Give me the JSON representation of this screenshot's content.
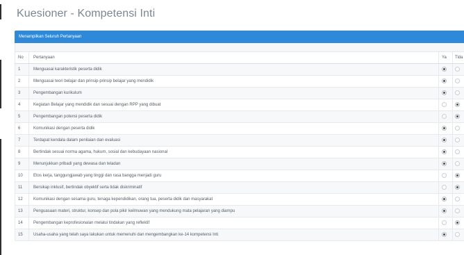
{
  "page": {
    "title": "Kuesioner - Kompetensi Inti"
  },
  "panel": {
    "header": "Menampilkan Seluruh Pertanyaan"
  },
  "table": {
    "headers": {
      "no": "No",
      "question": "Pertanyaan",
      "yes": "Ya",
      "no_answer": "Tida"
    },
    "rows": [
      {
        "no": "1",
        "question": "Menguasai karakteristik peserta didik",
        "answer": "ya"
      },
      {
        "no": "2",
        "question": "Menguasai teori belajar dan prinsip-prinsip belajar yang mendidik",
        "answer": "ya"
      },
      {
        "no": "3",
        "question": "Pengembangan kurikulum",
        "answer": "ya"
      },
      {
        "no": "4",
        "question": "Kegiatan Belajar yang mendidik dan sesuai dengan RPP yang dibuat",
        "answer": "tidak"
      },
      {
        "no": "5",
        "question": "Pengembangan potensi peserta didik",
        "answer": "tidak"
      },
      {
        "no": "6",
        "question": "Komunikasi dengan peserta didik",
        "answer": "ya"
      },
      {
        "no": "7",
        "question": "Terdapat kendala dalam penilaian dan evaluasi",
        "answer": "ya"
      },
      {
        "no": "8",
        "question": "Bertindak sesuai norma agama, hukum, sosial dan kebudayaan nasional",
        "answer": "ya"
      },
      {
        "no": "9",
        "question": "Menunjukkan pribadi yang dewasa dan teladan",
        "answer": "ya"
      },
      {
        "no": "10",
        "question": "Etos kerja, tanggungjawab yang tinggi dan rasa bangga menjadi guru",
        "answer": "tidak"
      },
      {
        "no": "11",
        "question": "Bersikap inklusif, bertindak obyektif serta tidak diskriminatif",
        "answer": "tidak"
      },
      {
        "no": "12",
        "question": "Komunikasi dengan sesama guru, tenaga kependidikan, orang tua, peserta didik dan masyarakat",
        "answer": "ya"
      },
      {
        "no": "13",
        "question": "Penguasaan materi, struktur, konsep dan pola pikir keilmuwan yang mendukung mata pelajaran yang diampu",
        "answer": "ya"
      },
      {
        "no": "14",
        "question": "Pengembangan keprofesionalan melalui tindakan yang reflektif",
        "answer": "tidak"
      },
      {
        "no": "15",
        "question": "Usaha-usaha yang telah saya lakukan untuk memenuhi dan mengembangkan ke-14 kompetensi Inti",
        "answer": "ya"
      }
    ]
  },
  "colors": {
    "header_bg": "#2e8ad8",
    "title_text": "#7b8794",
    "row_alt_bg": "#f7f8fa"
  }
}
